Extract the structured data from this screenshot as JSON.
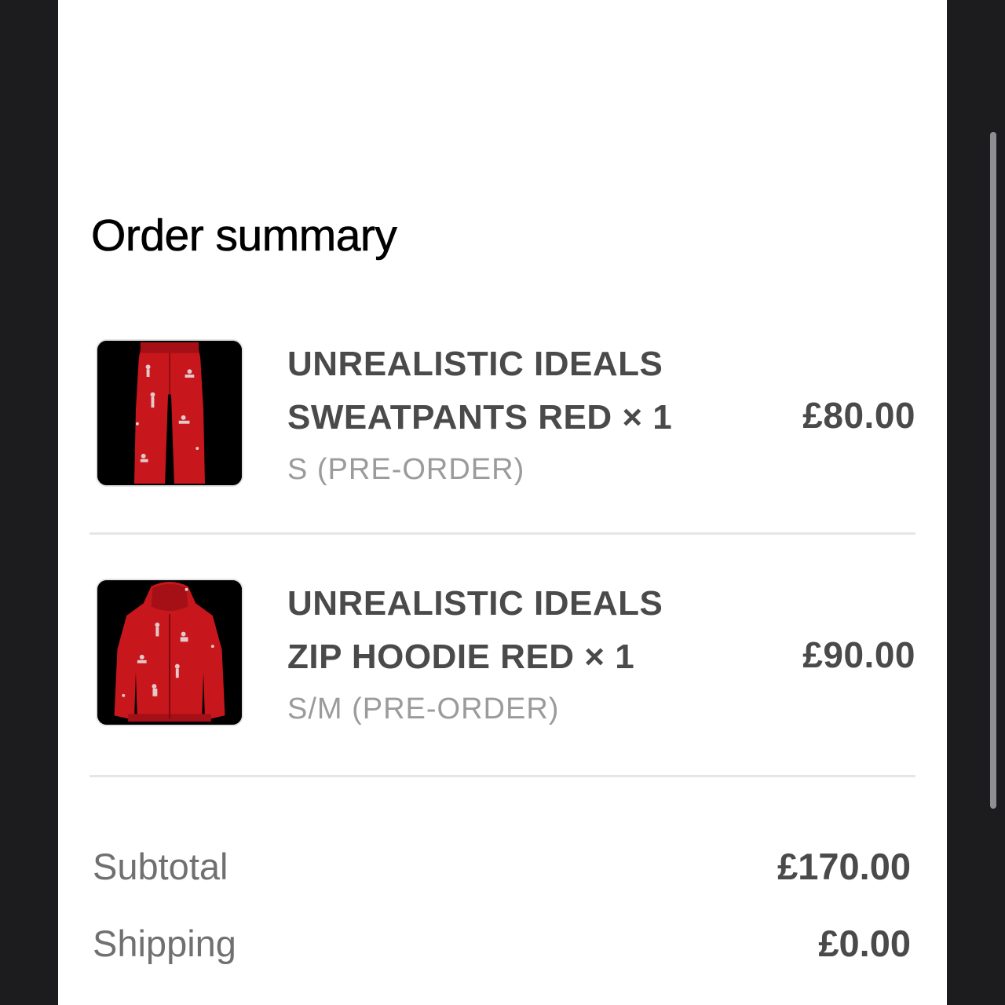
{
  "order_summary": {
    "title": "Order summary",
    "items": [
      {
        "name_line1": "UNREALISTIC IDEALS",
        "name_line2": "SWEATPANTS RED × 1",
        "variant": "S (PRE-ORDER)",
        "price": "£80.00",
        "thumbnail": "red-sweatpants-image"
      },
      {
        "name_line1": "UNREALISTIC IDEALS",
        "name_line2": "ZIP HOODIE RED × 1",
        "variant": "S/M (PRE-ORDER)",
        "price": "£90.00",
        "thumbnail": "red-zip-hoodie-image"
      }
    ],
    "subtotal": {
      "label": "Subtotal",
      "value": "£170.00"
    },
    "shipping": {
      "label": "Shipping",
      "value": "£0.00"
    }
  },
  "colors": {
    "background_dark": "#1c1c1e",
    "panel": "#ffffff",
    "product_red": "#c8161d",
    "text_primary": "#000000",
    "text_secondary": "#4a4a4a",
    "text_muted": "#9b9b9b",
    "divider": "#e6e6e6"
  }
}
